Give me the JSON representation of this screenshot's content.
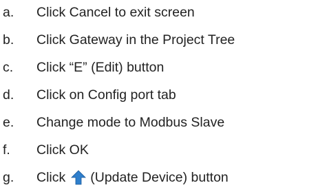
{
  "steps": [
    {
      "marker": "a.",
      "text": "Click Cancel to exit screen"
    },
    {
      "marker": "b.",
      "text": "Click Gateway in the Project Tree"
    },
    {
      "marker": "c.",
      "text": "Click “E” (Edit) button"
    },
    {
      "marker": "d.",
      "text": "Click on Config port tab"
    },
    {
      "marker": "e.",
      "text": "Change mode to Modbus Slave"
    },
    {
      "marker": "f.",
      "text": "Click OK"
    },
    {
      "marker": "g.",
      "text_before": "Click",
      "icon": "update-device-arrow-icon",
      "text_after": "(Update Device) button"
    }
  ],
  "colors": {
    "text": "#222222",
    "icon_fill": "#2f7fcc"
  }
}
